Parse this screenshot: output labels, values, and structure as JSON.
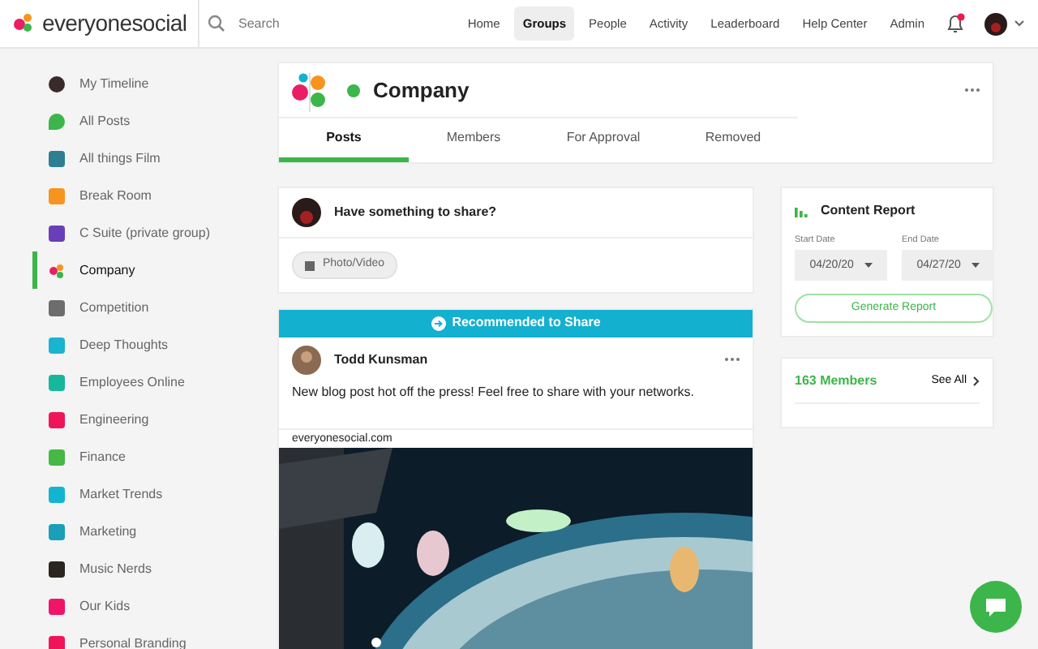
{
  "brand": {
    "name": "everyonesocial"
  },
  "search": {
    "placeholder": "Search"
  },
  "nav": [
    {
      "label": "Home",
      "selected": false
    },
    {
      "label": "Groups",
      "selected": true
    },
    {
      "label": "People",
      "selected": false
    },
    {
      "label": "Activity",
      "selected": false
    },
    {
      "label": "Leaderboard",
      "selected": false
    },
    {
      "label": "Help Center",
      "selected": false
    },
    {
      "label": "Admin",
      "selected": false
    }
  ],
  "notifications": {
    "unread": true
  },
  "sidebar": {
    "items": [
      {
        "label": "My Timeline",
        "selected": false,
        "kind": "avatar",
        "color": "#3a2a2a"
      },
      {
        "label": "All Posts",
        "selected": false,
        "kind": "bubble",
        "color": "#3cb54a"
      },
      {
        "label": "All things Film",
        "selected": false,
        "kind": "square",
        "color": "#2f7f93"
      },
      {
        "label": "Break Room",
        "selected": false,
        "kind": "square",
        "color": "#f7941d"
      },
      {
        "label": "C Suite (private group)",
        "selected": false,
        "kind": "square",
        "color": "#6a3eb8"
      },
      {
        "label": "Company",
        "selected": true,
        "kind": "logo",
        "color": "#e91e63"
      },
      {
        "label": "Competition",
        "selected": false,
        "kind": "square",
        "color": "#6d6d6d"
      },
      {
        "label": "Deep Thoughts",
        "selected": false,
        "kind": "square",
        "color": "#1ab4cf"
      },
      {
        "label": "Employees Online",
        "selected": false,
        "kind": "square",
        "color": "#16b79a"
      },
      {
        "label": "Engineering",
        "selected": false,
        "kind": "square",
        "color": "#f0145a"
      },
      {
        "label": "Finance",
        "selected": false,
        "kind": "square",
        "color": "#46b845"
      },
      {
        "label": "Market Trends",
        "selected": false,
        "kind": "square",
        "color": "#12b5cf"
      },
      {
        "label": "Marketing",
        "selected": false,
        "kind": "square",
        "color": "#1a9fb8"
      },
      {
        "label": "Music Nerds",
        "selected": false,
        "kind": "square",
        "color": "#2b2520"
      },
      {
        "label": "Our Kids",
        "selected": false,
        "kind": "square",
        "color": "#f0146a"
      },
      {
        "label": "Personal Branding",
        "selected": false,
        "kind": "square",
        "color": "#f0145a"
      }
    ]
  },
  "group": {
    "name": "Company",
    "online": true,
    "tabs": [
      {
        "label": "Posts",
        "selected": true
      },
      {
        "label": "Members",
        "selected": false
      },
      {
        "label": "For Approval",
        "selected": false
      },
      {
        "label": "Removed",
        "selected": false
      }
    ]
  },
  "composer": {
    "prompt": "Have something to share?",
    "attach": "Photo/Video"
  },
  "post": {
    "banner": "Recommended to Share",
    "author": "Todd Kunsman",
    "text": "New blog post hot off the press! Feel free to share with your networks.",
    "link_domain": "everyonesocial.com"
  },
  "report": {
    "title": "Content Report",
    "start_label": "Start Date",
    "start": "04/20/20",
    "end_label": "End Date",
    "end": "04/27/20",
    "button": "Generate Report"
  },
  "members": {
    "count": "163 Members",
    "see_all": "See All"
  }
}
